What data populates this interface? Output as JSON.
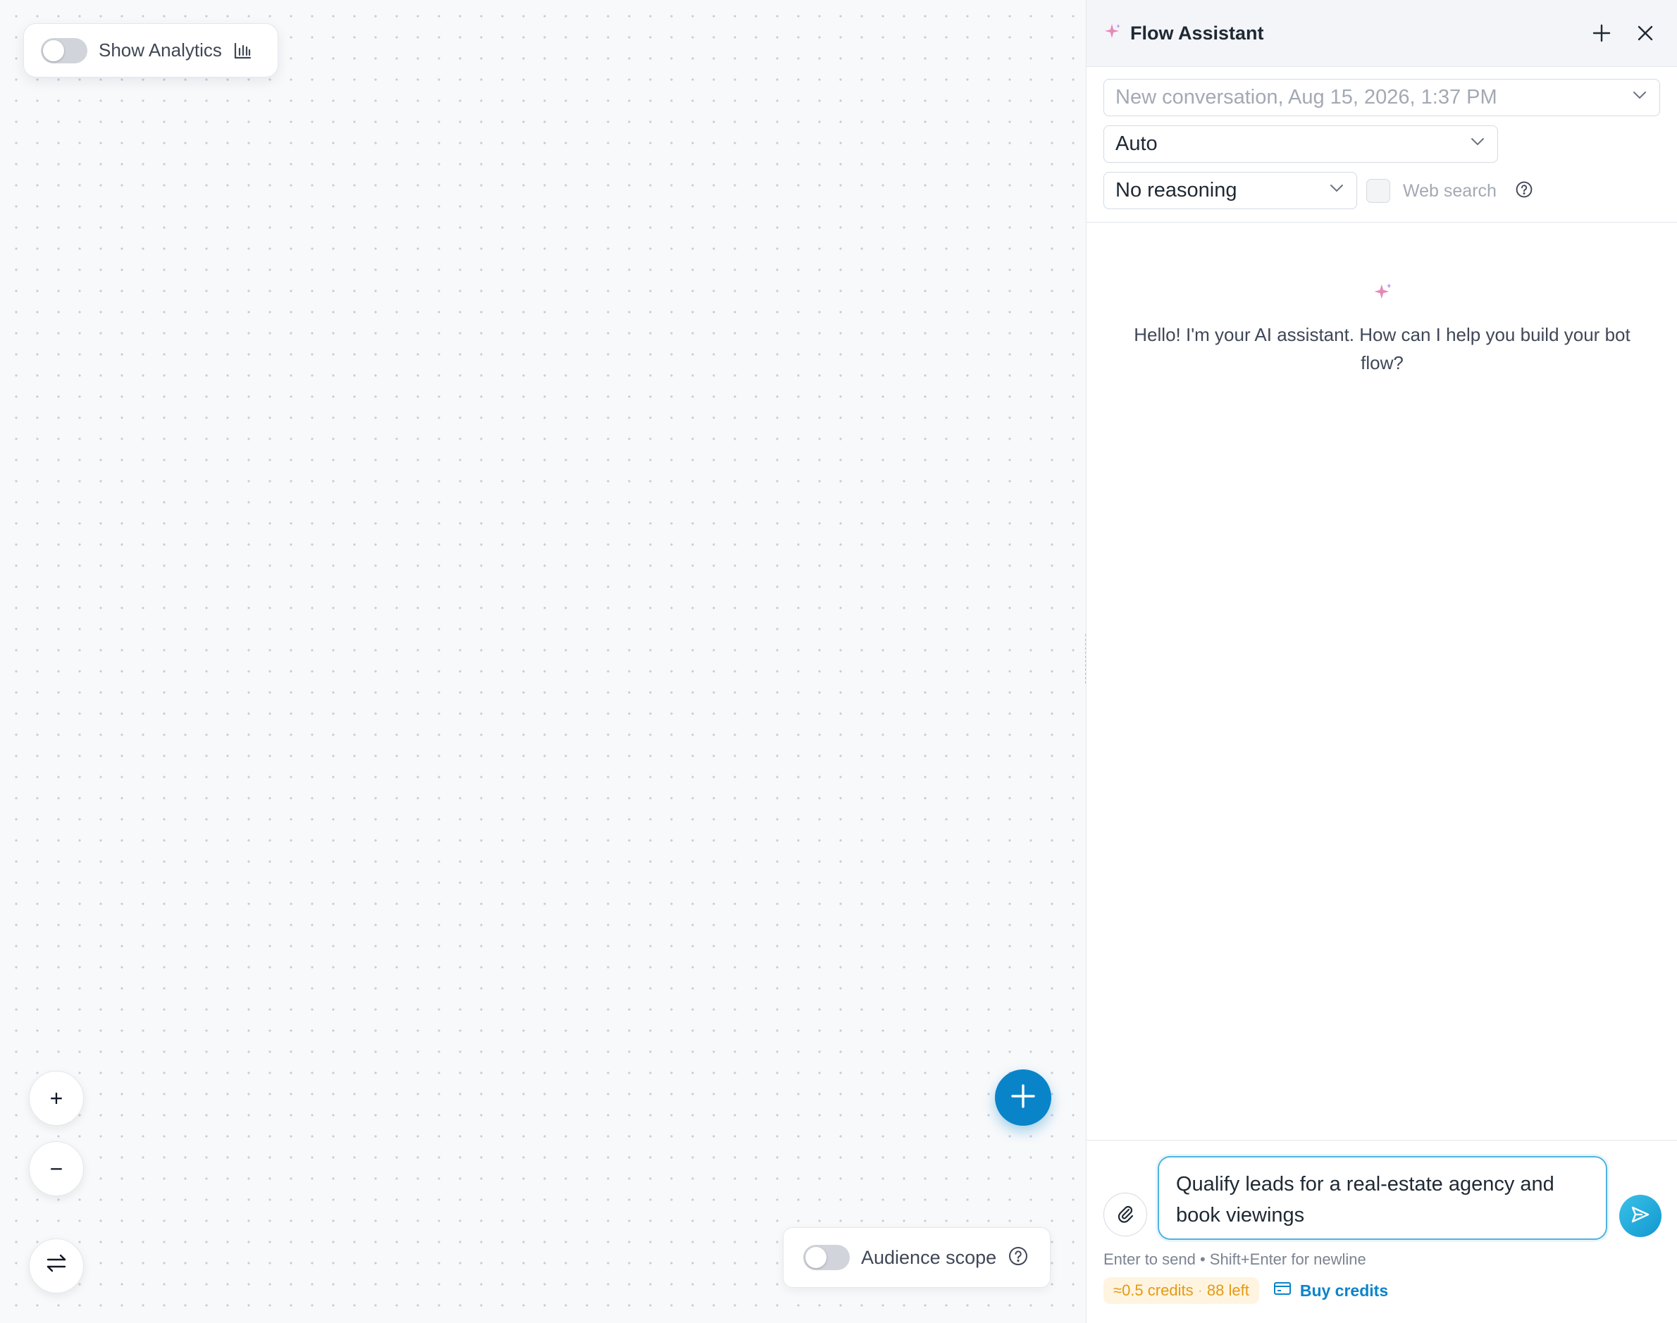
{
  "canvas": {
    "analytics_toggle_label": "Show Analytics",
    "analytics_toggle_on": false,
    "zoom_in_label": "+",
    "zoom_out_label": "−",
    "audience_scope_label": "Audience scope",
    "audience_scope_on": false
  },
  "assistant": {
    "title": "Flow Assistant",
    "conversation_select": "New conversation, Aug 15, 2026, 1:37 PM",
    "model_select": "Auto",
    "reasoning_select": "No reasoning",
    "web_search_label": "Web search",
    "web_search_checked": false,
    "greeting": "Hello! I'm your AI assistant. How can I help you build your bot flow?",
    "prompt_value": "Qualify leads for a real-estate agency and book viewings",
    "hint": "Enter to send • Shift+Enter for newline",
    "credits_cost": "≈0.5 credits",
    "credits_separator": "·",
    "credits_left": "88 left",
    "buy_credits_label": "Buy credits"
  },
  "colors": {
    "accent": "#0a84c9",
    "send_gradient_start": "#38c2e8",
    "credits_text": "#e39a12",
    "credits_bg": "#fff4e0"
  }
}
